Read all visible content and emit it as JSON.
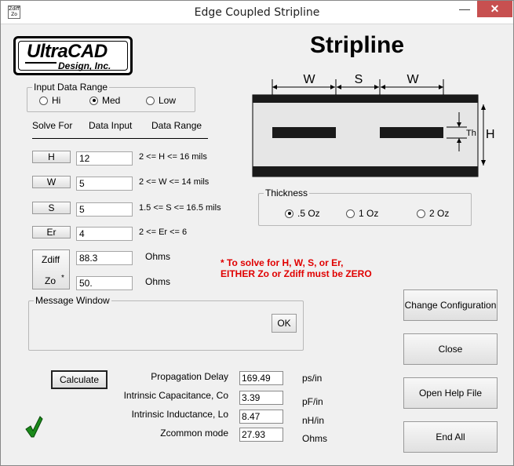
{
  "window": {
    "title": "Edge Coupled Stripline",
    "icon_text": "Zdiff Zo",
    "minimize_glyph": "—",
    "close_glyph": "✕"
  },
  "logo": {
    "line1": "UltraCAD",
    "line2": "Design, Inc."
  },
  "input_range": {
    "legend": "Input Data Range",
    "options": [
      {
        "label": "Hi",
        "selected": false
      },
      {
        "label": "Med",
        "selected": true
      },
      {
        "label": "Low",
        "selected": false
      }
    ]
  },
  "headers": {
    "solve_for": "Solve For",
    "data_input": "Data Input",
    "data_range": "Data Range"
  },
  "params": [
    {
      "button": "H",
      "value": "12",
      "range": "2 <= H <= 16 mils"
    },
    {
      "button": "W",
      "value": "5",
      "range": "2 <= W <= 14 mils"
    },
    {
      "button": "S",
      "value": "5",
      "range": "1.5 <= S <= 16.5 mils"
    },
    {
      "button": "Er",
      "value": "4",
      "range": "2 <= Er <= 6"
    }
  ],
  "impedance": {
    "zdiff_label": "Zdiff",
    "zo_label": "Zo",
    "zo_mark": "*",
    "zdiff_value": "88.3",
    "zo_value": "50.",
    "zdiff_unit": "Ohms",
    "zo_unit": "Ohms"
  },
  "warning": {
    "line1": "* To solve for H, W, S, or Er,",
    "line2": "EITHER Zo or Zdiff must be ZERO"
  },
  "message_window": {
    "legend": "Message Window",
    "ok_label": "OK"
  },
  "calculate_label": "Calculate",
  "outputs": [
    {
      "label": "Propagation Delay",
      "value": "169.49",
      "unit": "ps/in"
    },
    {
      "label": "Intrinsic Capacitance, Co",
      "value": "3.39",
      "unit": "pF/in"
    },
    {
      "label": "Intrinsic Inductance, Lo",
      "value": "8.47",
      "unit": "nH/in"
    },
    {
      "label": "Zcommon mode",
      "value": "27.93",
      "unit": "Ohms"
    }
  ],
  "stripline": {
    "title": "Stripline",
    "label_w1": "W",
    "label_s": "S",
    "label_w2": "W",
    "label_th": "Th",
    "label_h": "H"
  },
  "thickness": {
    "legend": "Thickness",
    "options": [
      {
        "label": ".5 Oz",
        "selected": true
      },
      {
        "label": "1 Oz",
        "selected": false
      },
      {
        "label": "2 Oz",
        "selected": false
      }
    ]
  },
  "right_buttons": {
    "change_config": "Change Configuration",
    "close": "Close",
    "help": "Open Help File",
    "end_all": "End All"
  },
  "colors": {
    "check": "#1a8a1a",
    "warning": "#e00000",
    "close_button": "#c75050"
  }
}
